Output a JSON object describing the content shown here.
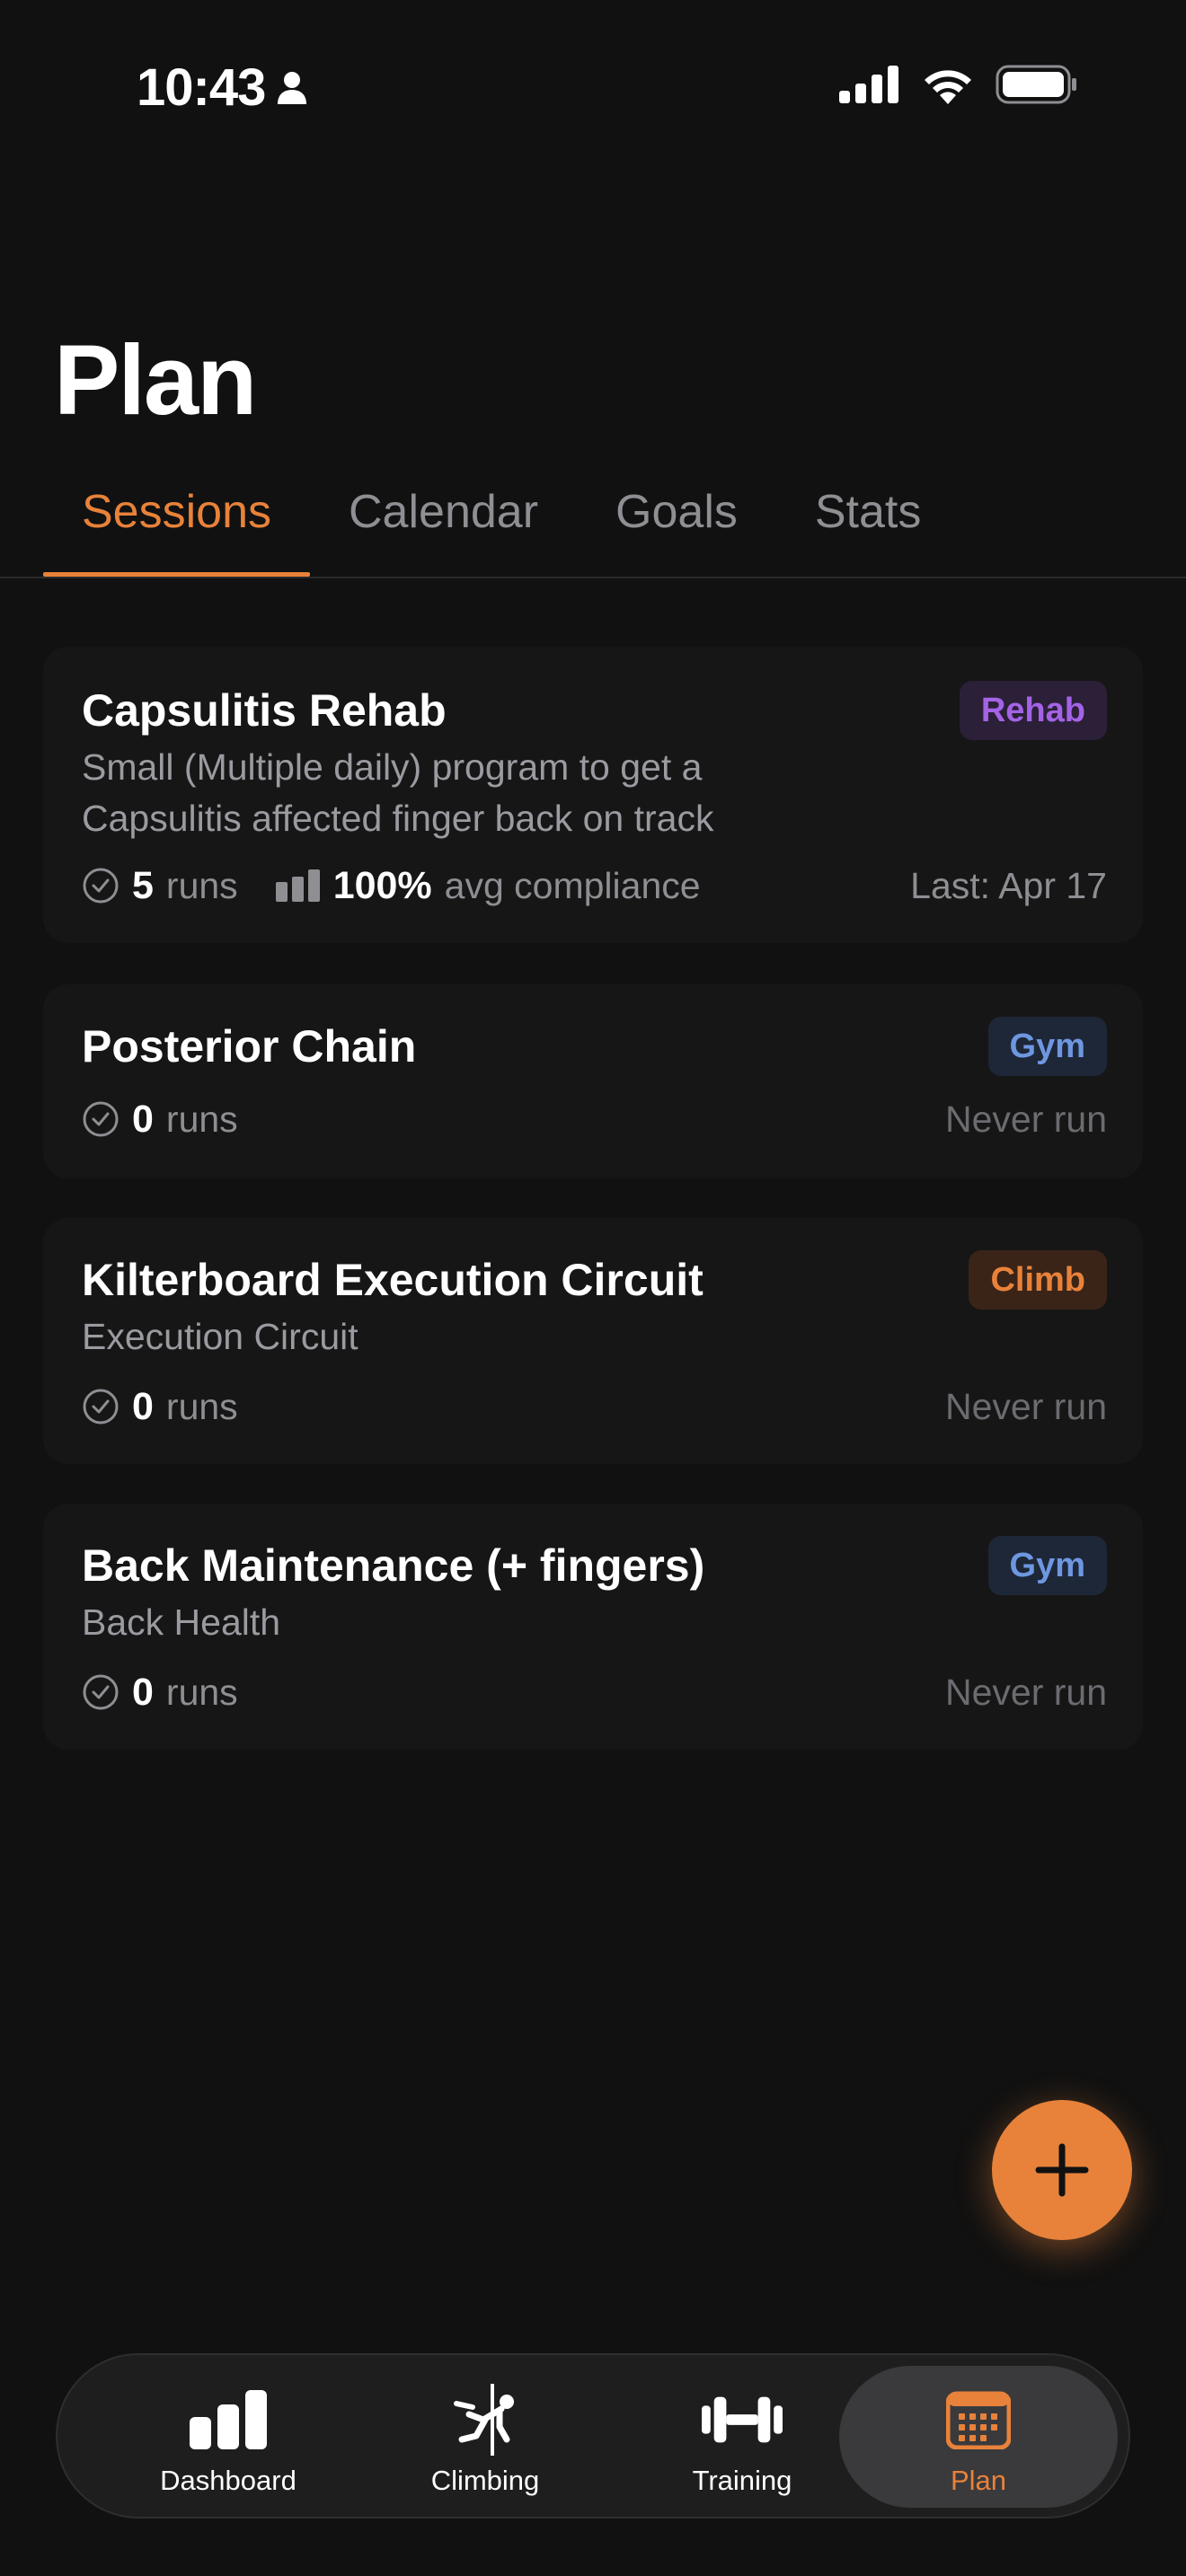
{
  "status_bar": {
    "time": "10:43"
  },
  "page": {
    "title": "Plan"
  },
  "tabs": [
    {
      "label": "Sessions",
      "active": true
    },
    {
      "label": "Calendar",
      "active": false
    },
    {
      "label": "Goals",
      "active": false
    },
    {
      "label": "Stats",
      "active": false
    }
  ],
  "sessions": [
    {
      "title": "Capsulitis Rehab",
      "badge": "Rehab",
      "description": "Small (Multiple daily) program to get a Capsulitis affected finger back on track",
      "runs_count": "5",
      "runs_label": "runs",
      "compliance_value": "100%",
      "compliance_label": "avg compliance",
      "last": "Last: Apr 17"
    },
    {
      "title": "Posterior Chain",
      "badge": "Gym",
      "runs_count": "0",
      "runs_label": "runs",
      "last": "Never run"
    },
    {
      "title": "Kilterboard Execution Circuit",
      "badge": "Climb",
      "description": "Execution Circuit",
      "runs_count": "0",
      "runs_label": "runs",
      "last": "Never run"
    },
    {
      "title": "Back Maintenance (+ fingers)",
      "badge": "Gym",
      "description": "Back Health",
      "runs_count": "0",
      "runs_label": "runs",
      "last": "Never run"
    }
  ],
  "tabbar": [
    {
      "label": "Dashboard",
      "icon": "bar-chart-icon",
      "active": false
    },
    {
      "label": "Climbing",
      "icon": "climber-icon",
      "active": false
    },
    {
      "label": "Training",
      "icon": "dumbbell-icon",
      "active": false
    },
    {
      "label": "Plan",
      "icon": "calendar-icon",
      "active": true
    }
  ],
  "colors": {
    "accent": "#E8823A",
    "rehab": "#A463E6",
    "gym": "#6E97E0",
    "background": "#111111"
  }
}
